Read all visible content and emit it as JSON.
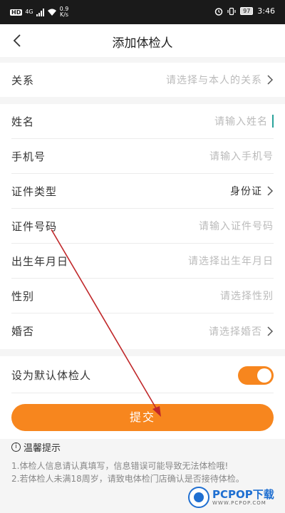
{
  "status_bar": {
    "hd": "HD",
    "network": "4G",
    "speed_value": "0.9",
    "speed_unit": "K/s",
    "battery": "97",
    "time": "3:46"
  },
  "nav": {
    "title": "添加体检人",
    "back_icon": "chevron-left-icon"
  },
  "relation": {
    "label": "关系",
    "placeholder": "请选择与本人的关系"
  },
  "form": {
    "name": {
      "label": "姓名",
      "placeholder": "请输入姓名"
    },
    "phone": {
      "label": "手机号",
      "placeholder": "请输入手机号"
    },
    "id_type": {
      "label": "证件类型",
      "value": "身份证"
    },
    "id_number": {
      "label": "证件号码",
      "placeholder": "请输入证件号码"
    },
    "birthdate": {
      "label": "出生年月日",
      "placeholder": "请选择出生年月日"
    },
    "gender": {
      "label": "性别",
      "placeholder": "请选择性别"
    },
    "marital": {
      "label": "婚否",
      "placeholder": "请选择婚否"
    }
  },
  "default_toggle": {
    "label": "设为默认体检人",
    "on": true
  },
  "submit_label": "提交",
  "tips": {
    "title": "温馨提示",
    "items": [
      "1.体检人信息请认真填写，信息错误可能导致无法体检哦!",
      "2.若体检人未满18周岁，请致电体检门店确认是否接待体检。"
    ]
  },
  "watermark": {
    "main": "PCPOP下载",
    "sub": "WWW.PCPOP.COM"
  },
  "colors": {
    "accent": "#f7861e",
    "annotation_arrow": "#c0282a",
    "cursor": "#2aa39a"
  }
}
